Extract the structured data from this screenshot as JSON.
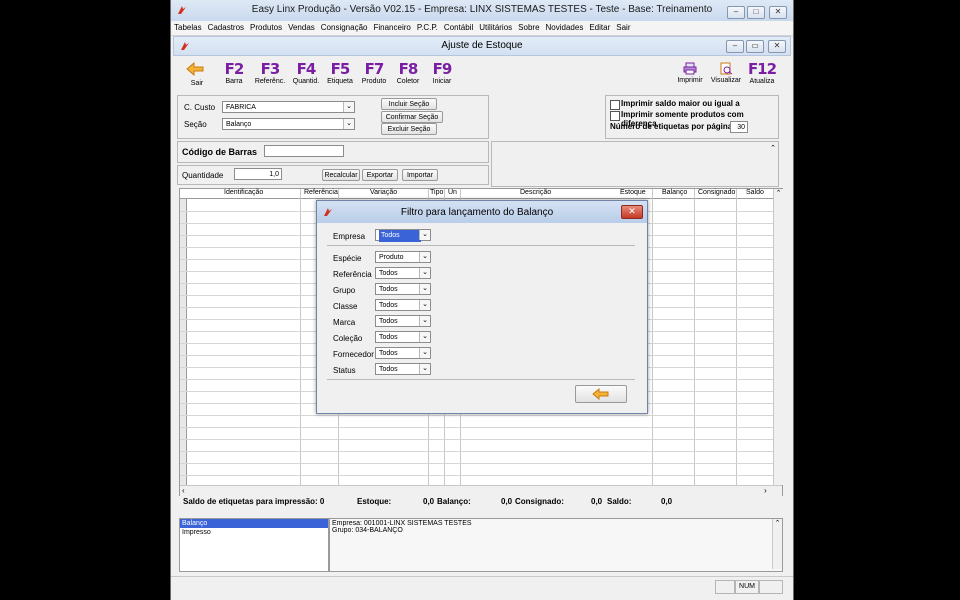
{
  "window": {
    "title": "Easy Linx Produção  -  Versão V02.15  -  Empresa: LINX SISTEMAS TESTES  -  Teste  -  Base: Treinamento",
    "controls": [
      "–",
      "□",
      "✕"
    ]
  },
  "menu": [
    "Tabelas",
    "Cadastros",
    "Produtos",
    "Vendas",
    "Consignação",
    "Financeiro",
    "P.C.P.",
    "Contábil",
    "Utilitários",
    "Sobre",
    "Novidades",
    "Editar",
    "Sair"
  ],
  "child_window": {
    "title": "Ajuste de Estoque",
    "controls": [
      "–",
      "▭",
      "✕"
    ]
  },
  "toolbar": {
    "sair_label": "Sair",
    "fkeys": [
      {
        "key": "F2",
        "label": "Barra"
      },
      {
        "key": "F3",
        "label": "Referênc."
      },
      {
        "key": "F4",
        "label": "Quantid."
      },
      {
        "key": "F5",
        "label": "Etiqueta"
      },
      {
        "key": "F7",
        "label": "Produto"
      },
      {
        "key": "F8",
        "label": "Coletor"
      },
      {
        "key": "F9",
        "label": "Iniciar"
      }
    ],
    "imprimir_label": "Imprimir",
    "visualizar_label": "Visualizar",
    "f12_key": "F12",
    "f12_label": "Atualiza"
  },
  "form": {
    "c_custo_label": "C. Custo",
    "c_custo_value": "FABRICA",
    "secao_label": "Seção",
    "secao_value": "Balanço",
    "incluir_secao": "Incluir Seção",
    "confirmar_secao": "Confirmar Seção",
    "excluir_secao": "Excluir Seção",
    "opt1": "Imprimir saldo maior ou igual a",
    "opt2": "Imprimir somente produtos com diferença",
    "num_etiquetas_label": "Número de etiquetas por página",
    "num_etiquetas_value": "30",
    "codigo_barras_label": "Código de Barras",
    "quantidade_label": "Quantidade",
    "quantidade_value": "1,0",
    "recalcular": "Recalcular",
    "exportar": "Exportar",
    "importar": "Importar"
  },
  "grid": {
    "columns": [
      "Identificação",
      "Referência",
      "Variação",
      "Tipo",
      "Un",
      "Descrição",
      "Estoque",
      "Balanço",
      "Consignado",
      "Saldo"
    ]
  },
  "totals": {
    "saldo_etiquetas": "Saldo de etiquetas para impressão: 0",
    "estoque_label": "Estoque:",
    "estoque_value": "0,0",
    "balanco_label": "Balanço:",
    "balanco_value": "0,0",
    "consignado_label": "Consignado:",
    "consignado_value": "0,0",
    "saldo_label": "Saldo:",
    "saldo_value": "0,0"
  },
  "bottom_list": [
    "Balanço",
    "Impresso"
  ],
  "bottom_info": [
    "Empresa: 001001-LINX SISTEMAS TESTES",
    "Grupo: 034-BALANÇO"
  ],
  "status_bar": {
    "num": "NUM"
  },
  "dialog": {
    "title": "Filtro para lançamento do Balanço",
    "empresa_label": "Empresa",
    "empresa_value": "Todos",
    "fields": [
      {
        "label": "Espécie",
        "value": "Produto"
      },
      {
        "label": "Referência",
        "value": "Todos"
      },
      {
        "label": "Grupo",
        "value": "Todos"
      },
      {
        "label": "Classe",
        "value": "Todos"
      },
      {
        "label": "Marca",
        "value": "Todos"
      },
      {
        "label": "Coleção",
        "value": "Todos"
      },
      {
        "label": "Fornecedor",
        "value": "Todos"
      },
      {
        "label": "Status",
        "value": "Todos"
      }
    ]
  },
  "colors": {
    "fkey": "#7a1fa3",
    "selection": "#3a63d8",
    "arrow": "#f0a020",
    "logo": "#d2301e"
  }
}
